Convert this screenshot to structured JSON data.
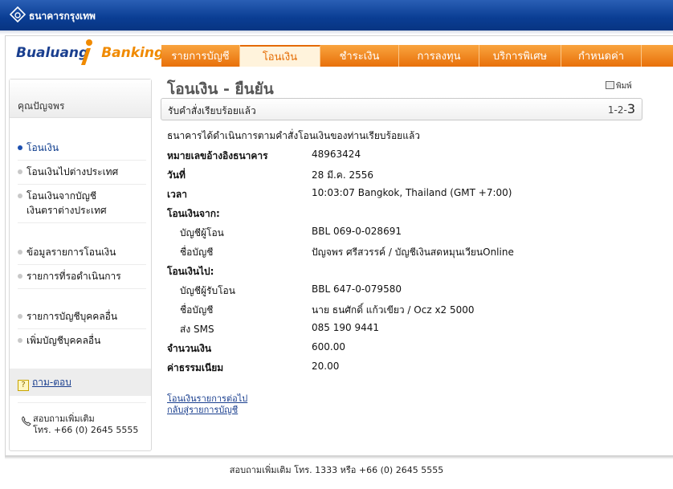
{
  "bank": {
    "name": "ธนาคารกรุงเทพ"
  },
  "brand": {
    "part1": "Bualuang",
    "part2": "Banking"
  },
  "tabs": [
    {
      "label": "รายการบัญชี",
      "active": false
    },
    {
      "label": "โอนเงิน",
      "active": true
    },
    {
      "label": "ชำระเงิน",
      "active": false
    },
    {
      "label": "การลงทุน",
      "active": false
    },
    {
      "label": "บริการพิเศษ",
      "active": false
    },
    {
      "label": "กำหนดค่า",
      "active": false
    }
  ],
  "sidebar": {
    "user": "คุณปัญจพร",
    "items": [
      {
        "label": "โอนเงิน",
        "active": true
      },
      {
        "label": "โอนเงินไปต่างประเทศ",
        "active": false
      },
      {
        "label": "โอนเงินจากบัญชี",
        "label2": "เงินตราต่างประเทศ",
        "active": false
      },
      {
        "label": "ข้อมูลรายการโอนเงิน",
        "active": false
      },
      {
        "label": "รายการที่รอดำเนินการ",
        "active": false
      },
      {
        "label": "รายการบัญชีบุคคลอื่น",
        "active": false
      },
      {
        "label": "เพิ่มบัญชีบุคคลอื่น",
        "active": false
      }
    ],
    "faq": "ถาม-ตอบ",
    "contact_line1": "สอบถามเพิ่มเติม",
    "contact_line2": "โทร. +66 (0) 2645 5555"
  },
  "main": {
    "title": "โอนเงิน - ยืนยัน",
    "print_label": "พิมพ์",
    "status_label": "รับคำสั่งเรียบร้อยแล้ว",
    "steps_prefix": "1-2-",
    "steps_current": "3",
    "intro": "ธนาคารได้ดำเนินการตามคำสั่งโอนเงินของท่านเรียบร้อยแล้ว",
    "fields": {
      "ref_label": "หมายเลขอ้างอิงธนาคาร",
      "ref_value": "48963424",
      "date_label": "วันที่",
      "date_value": "28 มี.ค. 2556",
      "time_label": "เวลา",
      "time_value": "10:03:07 Bangkok, Thailand (GMT +7:00)",
      "from_heading": "โอนเงินจาก:",
      "from_account_label": "บัญชีผู้โอน",
      "from_account_value": "BBL 069-0-028691",
      "from_name_label": "ชื่อบัญชี",
      "from_name_value": "ปัญจพร ศรีสวรรค์ / บัญชีเงินสดหมุนเวียนOnline",
      "to_heading": "โอนเงินไป:",
      "to_account_label": "บัญชีผู้รับโอน",
      "to_account_value": "BBL 647-0-079580",
      "to_name_label": "ชื่อบัญชี",
      "to_name_value": "นาย ธนศักดิ์ แก้วเขียว / Ocz x2 5000",
      "sms_label": "ส่ง SMS",
      "sms_value": "085 190 9441",
      "amount_label": "จำนวนเงิน",
      "amount_value": "600.00",
      "fee_label": "ค่าธรรมเนียม",
      "fee_value": "20.00"
    },
    "link_next": "โอนเงินรายการต่อไป",
    "link_back": "กลับสู่รายการบัญชี"
  },
  "footer": "สอบถามเพิ่มเติม โทร. 1333 หรือ +66 (0) 2645 5555"
}
